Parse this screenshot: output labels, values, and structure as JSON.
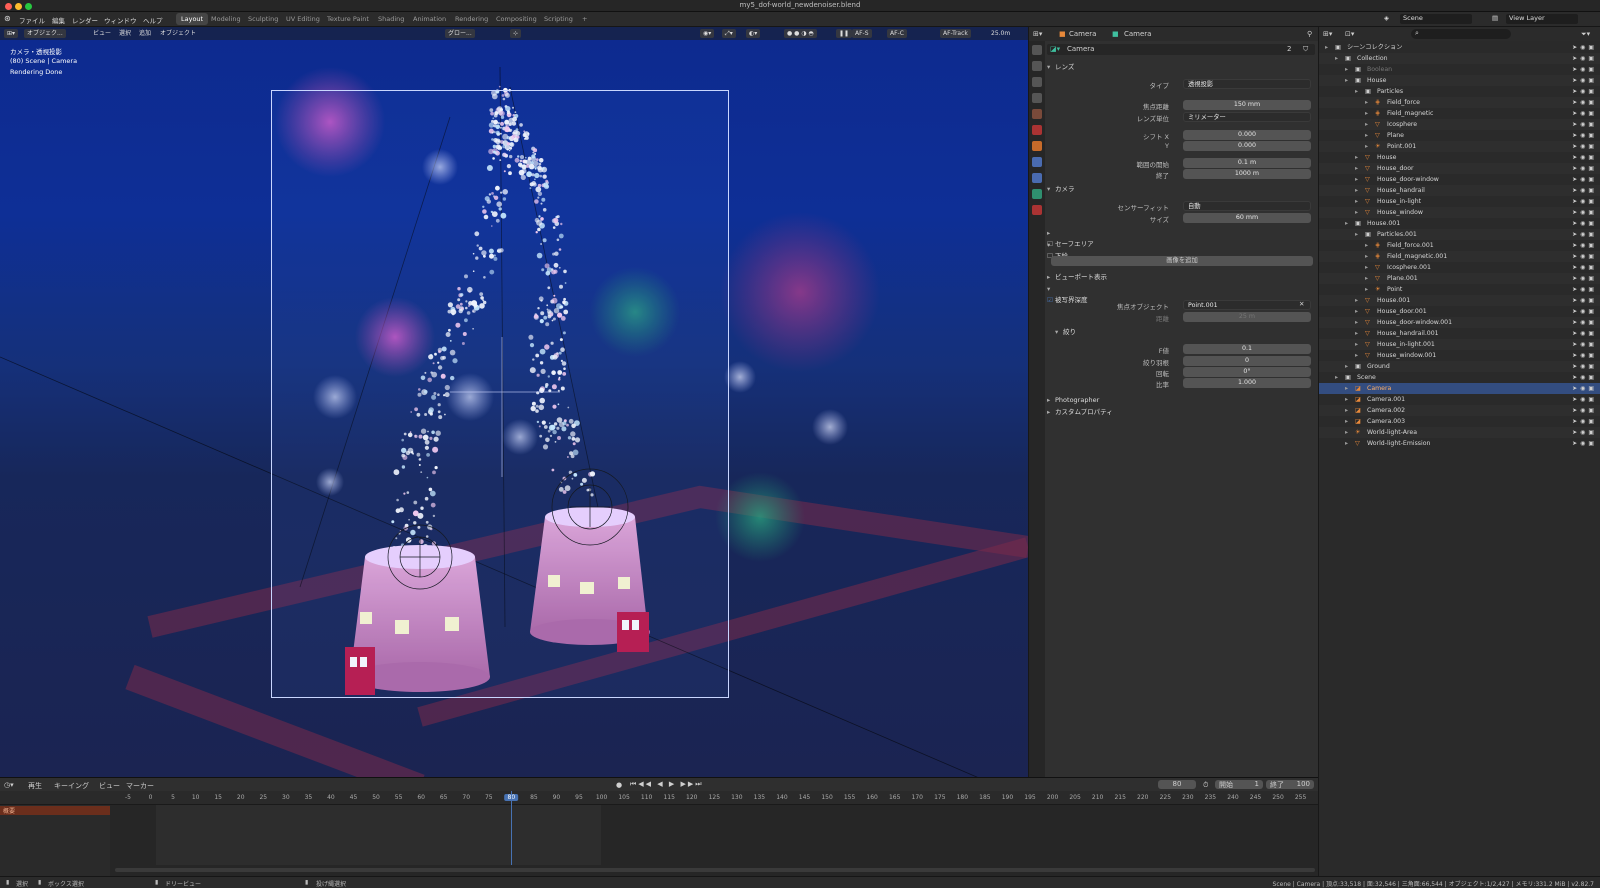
{
  "window": {
    "title": "my5_dof-world_newdenoiser.blend"
  },
  "menu": [
    "ファイル",
    "編集",
    "レンダー",
    "ウィンドウ",
    "ヘルプ"
  ],
  "workspaces": [
    "Layout",
    "Modeling",
    "Sculpting",
    "UV Editing",
    "Texture Paint",
    "Shading",
    "Animation",
    "Rendering",
    "Compositing",
    "Scripting"
  ],
  "scene_selector": {
    "scene": "Scene",
    "view_layer": "View Layer"
  },
  "viewport": {
    "header": {
      "mode": "オブジェク...",
      "view": "ビュー",
      "select": "選択",
      "add": "追加",
      "object": "オブジェクト",
      "orientation": "グロー...",
      "af_s": "AF-S",
      "af_c": "AF-C",
      "af_track": "AF-Track",
      "distance": "25.0m"
    },
    "overlay": {
      "line1": "カメラ・透視投影",
      "line2": "(80) Scene | Camera",
      "line3": "Rendering Done"
    }
  },
  "properties": {
    "header": {
      "camera_obj": "Camera",
      "camera_data": "Camera"
    },
    "datablock": {
      "name": "Camera",
      "users": "2"
    },
    "lens": {
      "title": "レンズ",
      "type_label": "タイプ",
      "type": "透視投影",
      "focal_label": "焦点距離",
      "focal": "150 mm",
      "unit_label": "レンズ単位",
      "unit": "ミリメーター",
      "shiftx_label": "シフト X",
      "shiftx": "0.000",
      "shifty_label": "Y",
      "shifty": "0.000",
      "clip_start_label": "範囲の開始",
      "clip_start": "0.1 m",
      "clip_end_label": "終了",
      "clip_end": "1000 m"
    },
    "camera": {
      "title": "カメラ",
      "fit_label": "センサーフィット",
      "fit": "自動",
      "size_label": "サイズ",
      "size": "60 mm"
    },
    "safe_area": "セーフエリア",
    "background": "下絵",
    "add_image": "画像を追加",
    "viewport_display": "ビューポート表示",
    "dof": {
      "title": "被写界深度",
      "focus_obj_label": "焦点オブジェクト",
      "focus_obj": "Point.001",
      "distance_label": "距離",
      "distance": "25 m",
      "aperture_title": "絞り",
      "fstop_label": "F値",
      "fstop": "0.1",
      "blades_label": "絞り羽根",
      "blades": "0",
      "rotation_label": "回転",
      "rotation": "0°",
      "ratio_label": "比率",
      "ratio": "1.000"
    },
    "photographer": "Photographer",
    "custom_props": "カスタムプロパティ"
  },
  "outliner": {
    "rows": [
      {
        "name": "シーンコレクション",
        "indent": 0,
        "icon": "collection-icon"
      },
      {
        "name": "Collection",
        "indent": 1,
        "icon": "collection-icon"
      },
      {
        "name": "Boolean",
        "indent": 2,
        "icon": "collection-icon",
        "dim": true
      },
      {
        "name": "House",
        "indent": 2,
        "icon": "collection-icon"
      },
      {
        "name": "Particles",
        "indent": 3,
        "icon": "collection-icon"
      },
      {
        "name": "Field_force",
        "indent": 4,
        "icon": "field-icon"
      },
      {
        "name": "Field_magnetic",
        "indent": 4,
        "icon": "field-icon"
      },
      {
        "name": "Icosphere",
        "indent": 4,
        "icon": "mesh-icon"
      },
      {
        "name": "Plane",
        "indent": 4,
        "icon": "mesh-icon"
      },
      {
        "name": "Point.001",
        "indent": 4,
        "icon": "light-icon"
      },
      {
        "name": "House",
        "indent": 3,
        "icon": "mesh-icon"
      },
      {
        "name": "House_door",
        "indent": 3,
        "icon": "mesh-icon"
      },
      {
        "name": "House_door-window",
        "indent": 3,
        "icon": "mesh-icon"
      },
      {
        "name": "House_handrail",
        "indent": 3,
        "icon": "mesh-icon"
      },
      {
        "name": "House_in-light",
        "indent": 3,
        "icon": "mesh-icon"
      },
      {
        "name": "House_window",
        "indent": 3,
        "icon": "mesh-icon"
      },
      {
        "name": "House.001",
        "indent": 2,
        "icon": "collection-icon"
      },
      {
        "name": "Particles.001",
        "indent": 3,
        "icon": "collection-icon"
      },
      {
        "name": "Field_force.001",
        "indent": 4,
        "icon": "field-icon"
      },
      {
        "name": "Field_magnetic.001",
        "indent": 4,
        "icon": "field-icon"
      },
      {
        "name": "Icosphere.001",
        "indent": 4,
        "icon": "mesh-icon"
      },
      {
        "name": "Plane.001",
        "indent": 4,
        "icon": "mesh-icon"
      },
      {
        "name": "Point",
        "indent": 4,
        "icon": "light-icon"
      },
      {
        "name": "House.001",
        "indent": 3,
        "icon": "mesh-icon"
      },
      {
        "name": "House_door.001",
        "indent": 3,
        "icon": "mesh-icon"
      },
      {
        "name": "House_door-window.001",
        "indent": 3,
        "icon": "mesh-icon"
      },
      {
        "name": "House_handrail.001",
        "indent": 3,
        "icon": "mesh-icon"
      },
      {
        "name": "House_in-light.001",
        "indent": 3,
        "icon": "mesh-icon"
      },
      {
        "name": "House_window.001",
        "indent": 3,
        "icon": "mesh-icon"
      },
      {
        "name": "Ground",
        "indent": 2,
        "icon": "collection-icon"
      },
      {
        "name": "Scene",
        "indent": 1,
        "icon": "collection-icon"
      },
      {
        "name": "Camera",
        "indent": 2,
        "icon": "camera-icon",
        "selected": true
      },
      {
        "name": "Camera.001",
        "indent": 2,
        "icon": "camera-icon"
      },
      {
        "name": "Camera.002",
        "indent": 2,
        "icon": "camera-icon"
      },
      {
        "name": "Camera.003",
        "indent": 2,
        "icon": "camera-icon"
      },
      {
        "name": "World-light-Area",
        "indent": 2,
        "icon": "light-icon"
      },
      {
        "name": "World-light-Emission",
        "indent": 2,
        "icon": "mesh-icon"
      }
    ]
  },
  "timeline": {
    "menus": [
      "再生",
      "キーイング",
      "ビュー",
      "マーカー"
    ],
    "current_frame": "80",
    "start_label": "開始",
    "start": "1",
    "end_label": "終了",
    "end": "100",
    "ticks": [
      "-5",
      "0",
      "5",
      "10",
      "15",
      "20",
      "25",
      "30",
      "35",
      "40",
      "45",
      "50",
      "55",
      "60",
      "65",
      "70",
      "75",
      "80",
      "85",
      "90",
      "95",
      "100",
      "105",
      "110",
      "115",
      "120",
      "125",
      "130",
      "135",
      "140",
      "145",
      "150",
      "155",
      "160",
      "165",
      "170",
      "175",
      "180",
      "185",
      "190",
      "195",
      "200",
      "205",
      "210",
      "215",
      "220",
      "225",
      "230",
      "235",
      "240",
      "245",
      "250",
      "255"
    ],
    "summary": "概要"
  },
  "statusbar": {
    "select": "選択",
    "box_select": "ボックス選択",
    "dolly": "ドリービュー",
    "lasso": "投げ縄選択",
    "info": "Scene | Camera | 頂点:33,518 | 面:32,546 | 三角面:66,544 | オブジェクト:1/2,427 | メモリ:331.2 MiB | v2.82.7"
  },
  "colors": {
    "accent": "#4772b3",
    "selected_row": "#334d80",
    "viewport_sky": "#0e2f96",
    "orange": "#e8893a",
    "teal": "#3fbf9f"
  }
}
